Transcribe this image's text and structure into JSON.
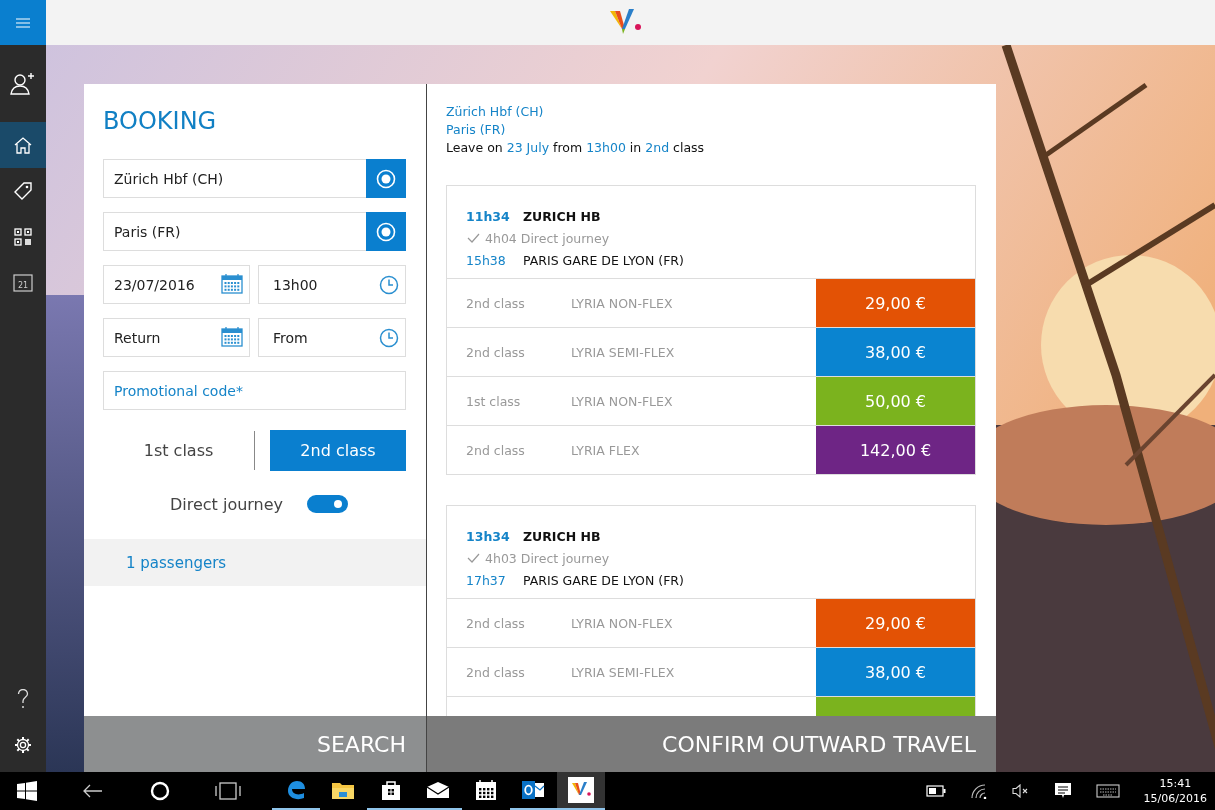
{
  "nav": {
    "top_items": [
      {
        "kind": "add-user",
        "selected": false
      },
      {
        "kind": "home",
        "selected": true
      },
      {
        "kind": "tag",
        "selected": false
      },
      {
        "kind": "qr",
        "selected": false
      },
      {
        "kind": "calendar",
        "selected": false,
        "text": "21"
      }
    ],
    "bottom_items": [
      {
        "kind": "help",
        "selected": false
      },
      {
        "kind": "settings",
        "selected": false
      }
    ]
  },
  "booking": {
    "title": "BOOKING",
    "origin": "Zürich Hbf (CH)",
    "destination": "Paris (FR)",
    "date_fields": [
      {
        "kind": "date",
        "value": "23/07/2016"
      },
      {
        "kind": "time",
        "value": "13h00"
      },
      {
        "kind": "date",
        "placeholder": "Return"
      },
      {
        "kind": "time",
        "placeholder": "From"
      }
    ],
    "promo": {
      "placeholder": "Promotional code*"
    },
    "classes": [
      {
        "label": "1st class",
        "selected": false
      },
      {
        "label": "2nd class",
        "selected": true
      }
    ],
    "direct_journey": {
      "label": "Direct journey",
      "on": true
    },
    "passengers": "1 passengers",
    "search_button": "SEARCH"
  },
  "results": {
    "origin": "Zürich Hbf (CH)",
    "destination": "Paris (FR)",
    "summary": [
      {
        "text": "Leave on",
        "highlight": false
      },
      {
        "text": "23 July",
        "highlight": true
      },
      {
        "text": "from",
        "highlight": false
      },
      {
        "text": "13h00",
        "highlight": true
      },
      {
        "text": "in",
        "highlight": false
      },
      {
        "text": "2nd",
        "highlight": true
      },
      {
        "text": "class",
        "highlight": false
      }
    ],
    "trips": [
      {
        "depart_time": "11h34",
        "depart_station": "ZURICH HB",
        "duration": "4h04 Direct journey",
        "arrive_time": "15h38",
        "arrive_station": "PARIS GARE DE LYON (FR)",
        "fares": [
          {
            "class": "2nd class",
            "name": "LYRIA NON-FLEX",
            "price": "29,00 €",
            "color": "#e35205"
          },
          {
            "class": "2nd class",
            "name": "LYRIA SEMI-FLEX",
            "price": "38,00 €",
            "color": "#0a84d0"
          },
          {
            "class": "1st class",
            "name": "LYRIA NON-FLEX",
            "price": "50,00 €",
            "color": "#7bb31e"
          },
          {
            "class": "2nd class",
            "name": "LYRIA FLEX",
            "price": "142,00 €",
            "color": "#6e2585"
          }
        ]
      },
      {
        "depart_time": "13h34",
        "depart_station": "ZURICH HB",
        "duration": "4h03 Direct journey",
        "arrive_time": "17h37",
        "arrive_station": "PARIS GARE DE LYON (FR)",
        "fares": [
          {
            "class": "2nd class",
            "name": "LYRIA NON-FLEX",
            "price": "29,00 €",
            "color": "#e35205"
          },
          {
            "class": "2nd class",
            "name": "LYRIA SEMI-FLEX",
            "price": "38,00 €",
            "color": "#0a84d0"
          },
          {
            "color": "#7bb31e"
          }
        ]
      }
    ],
    "confirm_button": "CONFIRM OUTWARD TRAVEL"
  },
  "taskbar": {
    "apps": [
      {
        "kind": "edge",
        "running": true,
        "selected": false
      },
      {
        "kind": "explorer",
        "running": false,
        "selected": false
      },
      {
        "kind": "store",
        "running": true,
        "selected": false
      },
      {
        "kind": "mail",
        "running": true,
        "selected": false
      },
      {
        "kind": "calendar",
        "running": false,
        "selected": false
      },
      {
        "kind": "outlook",
        "running": true,
        "selected": false
      },
      {
        "kind": "app",
        "running": true,
        "selected": true
      }
    ],
    "time": "15:41",
    "date": "15/06/2016"
  }
}
